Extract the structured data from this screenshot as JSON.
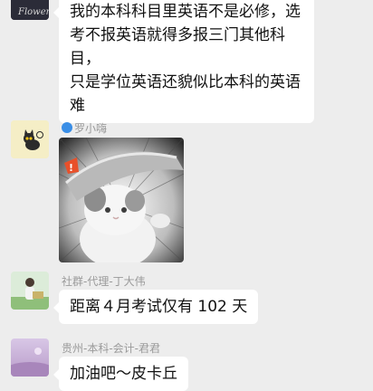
{
  "messages": [
    {
      "sender": "",
      "text": "我的本科科目里英语不是必修，选\n考不报英语就得多报三门其他科目，\n只是学位英语还貌似比本科的英语\n难"
    },
    {
      "sender": "罗小嗨",
      "image": "cat-meme-photo"
    },
    {
      "sender": "社群-代理-丁大伟",
      "text": "距离４月考试仅有 102 天"
    },
    {
      "sender": "贵州-本科-会计-君君",
      "text": "加油吧～皮卡丘"
    }
  ],
  "avatars": {
    "first": "Flower",
    "second": "cat-icon"
  },
  "colors": {
    "background": "#ededed",
    "bubble": "#ffffff",
    "sender_text": "#9a9a9a"
  }
}
